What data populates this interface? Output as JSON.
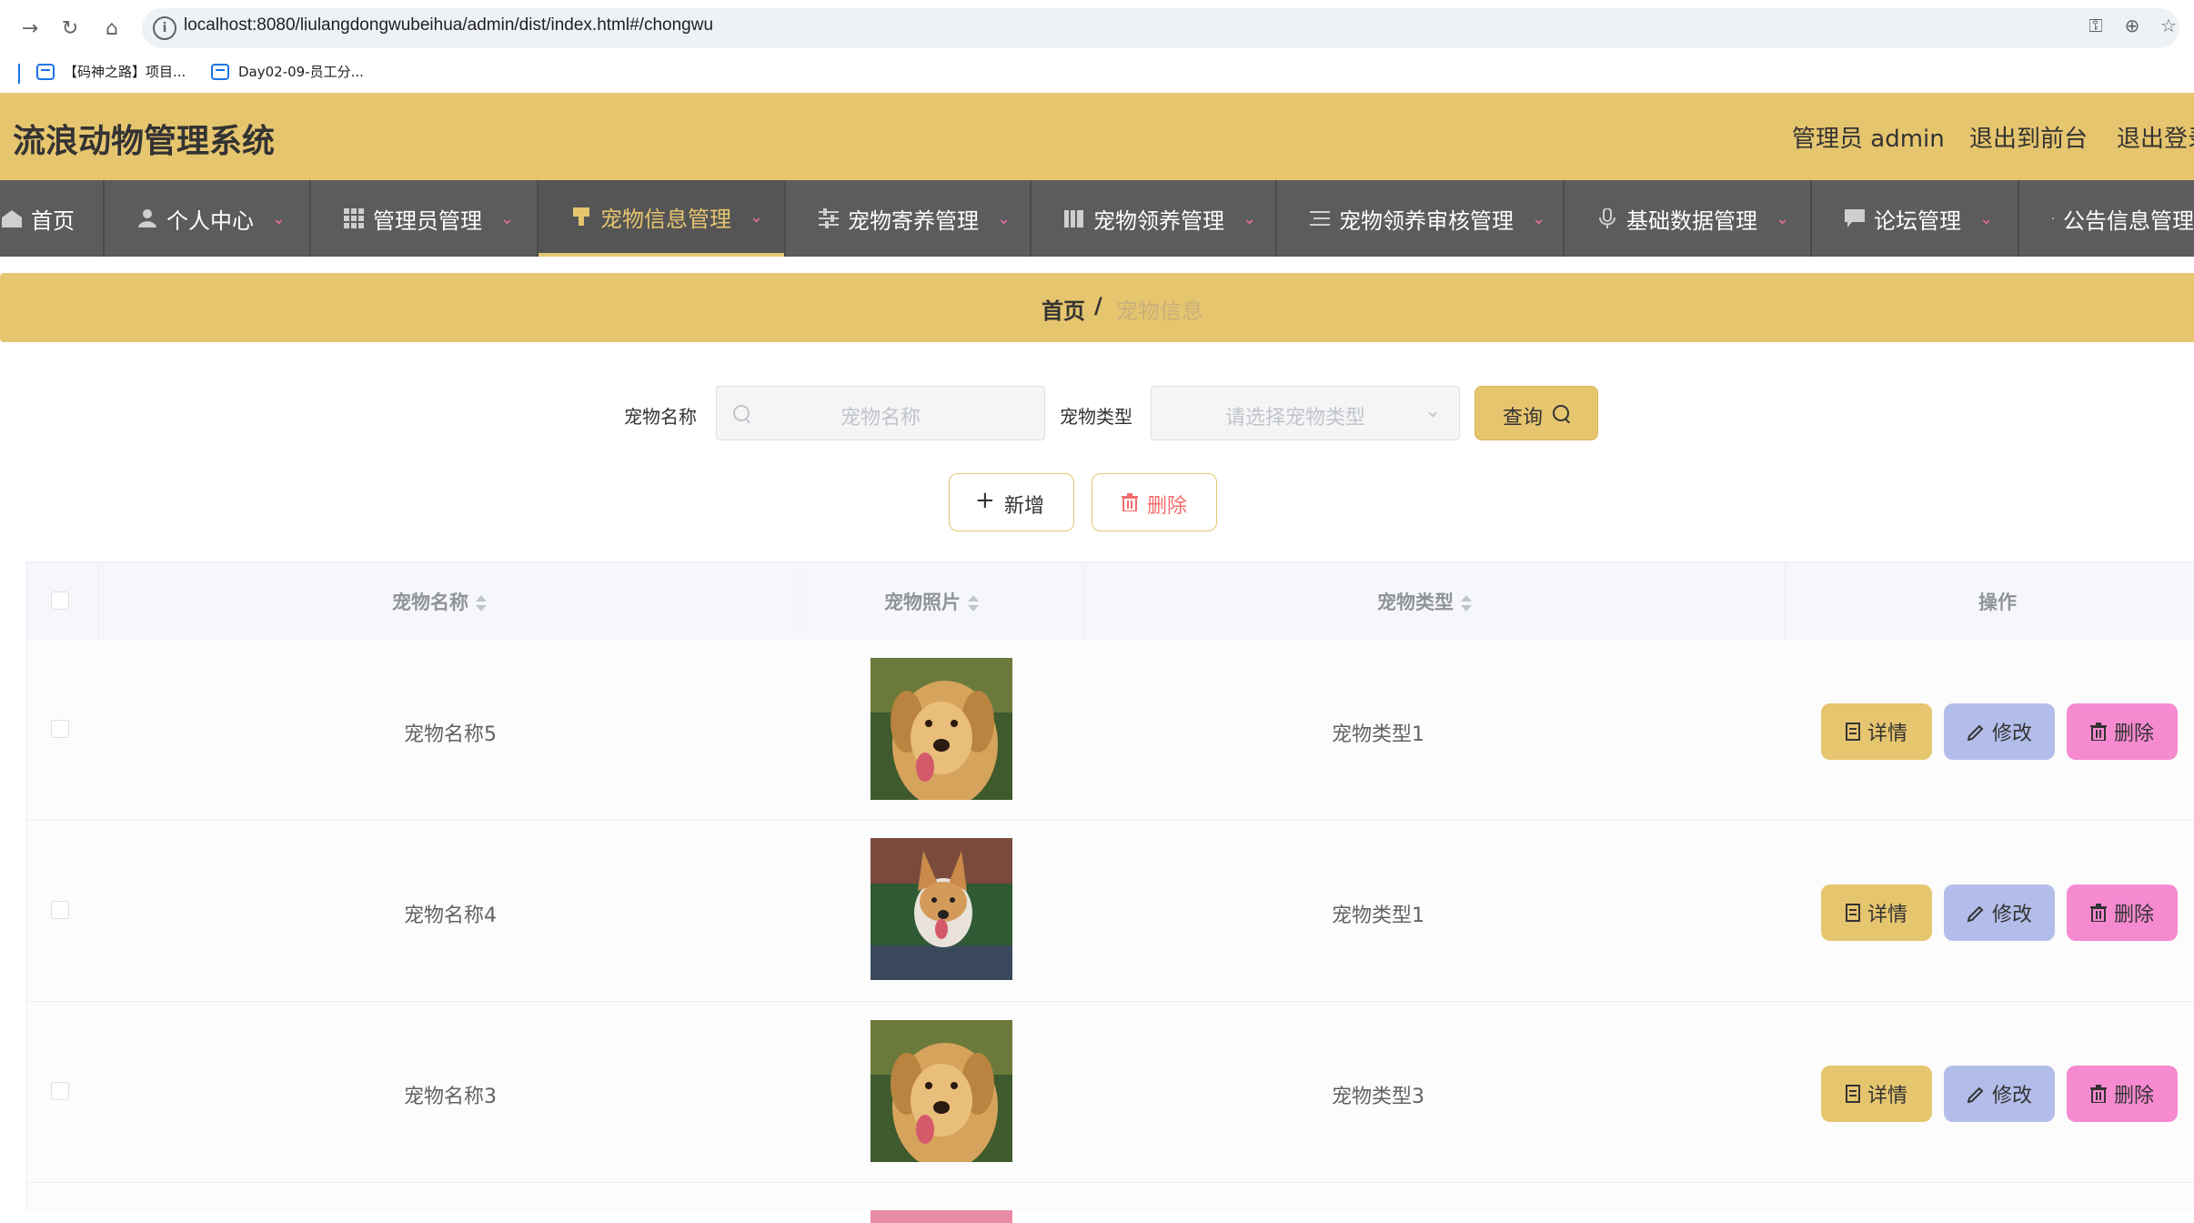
{
  "browser": {
    "url": "localhost:8080/liulangdongwubeihua/admin/dist/index.html#/chongwu",
    "bookmarks": [
      "【码神之路】项目...",
      "Day02-09-员工分..."
    ]
  },
  "header": {
    "title": "流浪动物管理系统",
    "user_label": "管理员 admin",
    "to_front": "退出到前台",
    "logout": "退出登录"
  },
  "nav": {
    "items": [
      {
        "label": "首页",
        "icon": "home-icon"
      },
      {
        "label": "个人中心",
        "icon": "user-icon"
      },
      {
        "label": "管理员管理",
        "icon": "grid-icon"
      },
      {
        "label": "宠物信息管理",
        "icon": "brush-icon"
      },
      {
        "label": "宠物寄养管理",
        "icon": "sliders-icon"
      },
      {
        "label": "宠物领养管理",
        "icon": "books-icon"
      },
      {
        "label": "宠物领养审核管理",
        "icon": "list-icon"
      },
      {
        "label": "基础数据管理",
        "icon": "mic-icon"
      },
      {
        "label": "论坛管理",
        "icon": "chat-icon"
      },
      {
        "label": "公告信息管理",
        "icon": "clipboard-icon"
      }
    ],
    "active_index": 3
  },
  "breadcrumb": {
    "home": "首页",
    "sep": "/",
    "current": "宠物信息"
  },
  "search": {
    "name_label": "宠物名称",
    "name_placeholder": "宠物名称",
    "type_label": "宠物类型",
    "type_placeholder": "请选择宠物类型",
    "query_label": "查询"
  },
  "toolbar": {
    "add_label": "新增",
    "delete_label": "删除"
  },
  "table": {
    "headers": [
      "宠物名称",
      "宠物照片",
      "宠物类型",
      "操作"
    ],
    "rows": [
      {
        "name": "宠物名称5",
        "type": "宠物类型1",
        "photo": "golden-retriever"
      },
      {
        "name": "宠物名称4",
        "type": "宠物类型1",
        "photo": "corgi"
      },
      {
        "name": "宠物名称3",
        "type": "宠物类型3",
        "photo": "golden-retriever"
      }
    ],
    "actions": {
      "detail": "详情",
      "edit": "修改",
      "delete": "删除"
    }
  },
  "colors": {
    "accent": "#e6c56f",
    "nav_bg": "#5c5c5c",
    "detail_btn": "#e6c56f",
    "edit_btn": "#b3bde9",
    "delete_btn": "#f58ad0"
  }
}
